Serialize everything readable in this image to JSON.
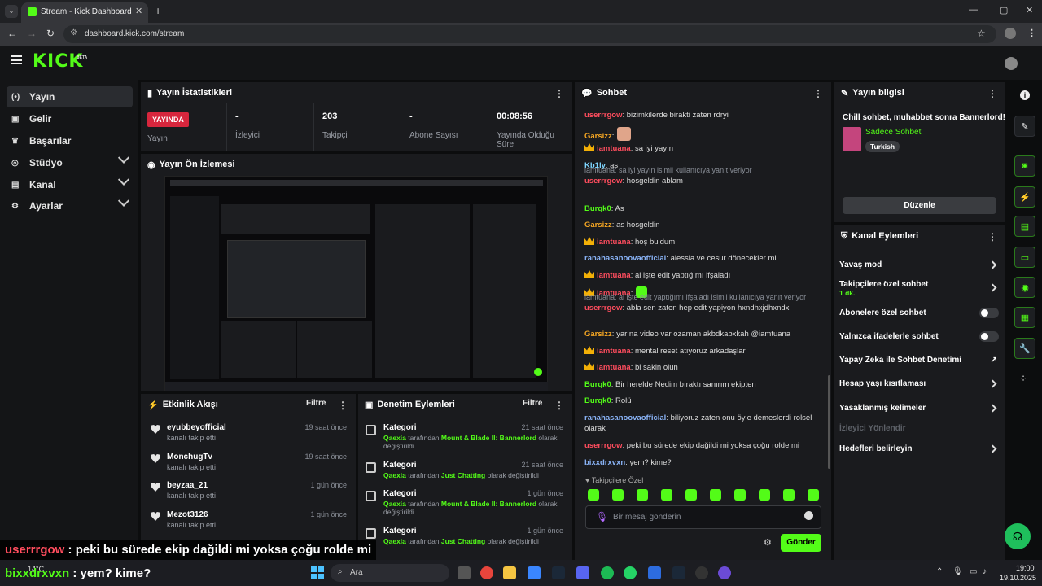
{
  "browser": {
    "tab_title": "Stream - Kick Dashboard",
    "url": "dashboard.kick.com/stream"
  },
  "brand": {
    "logo": "KICK",
    "badge": "BETA"
  },
  "sidebar": {
    "items": [
      {
        "label": "Yayın",
        "icon": "broadcast-icon"
      },
      {
        "label": "Gelir",
        "icon": "revenue-icon"
      },
      {
        "label": "Başarılar",
        "icon": "trophy-icon"
      },
      {
        "label": "Stüdyo",
        "icon": "studio-icon"
      },
      {
        "label": "Kanal",
        "icon": "channel-icon"
      },
      {
        "label": "Ayarlar",
        "icon": "gear-icon"
      }
    ]
  },
  "stats": {
    "title": "Yayın İstatistikleri",
    "live_badge": "YAYINDA",
    "live_label": "Yayın",
    "cells": [
      {
        "value": "-",
        "label": "İzleyici"
      },
      {
        "value": "203",
        "label": "Takipçi"
      },
      {
        "value": "-",
        "label": "Abone Sayısı"
      },
      {
        "value": "00:08:56",
        "label": "Yayında Olduğu Süre"
      }
    ]
  },
  "preview": {
    "title": "Yayın Ön İzlemesi"
  },
  "activity": {
    "title": "Etkinlik Akışı",
    "filter": "Filtre",
    "items": [
      {
        "name": "eyubbeyofficial",
        "sub": "kanalı takip etti",
        "time": "19 saat önce"
      },
      {
        "name": "MonchugTv",
        "sub": "kanalı takip etti",
        "time": "19 saat önce"
      },
      {
        "name": "beyzaa_21",
        "sub": "kanalı takip etti",
        "time": "1 gün önce"
      },
      {
        "name": "Mezot3126",
        "sub": "kanalı takip etti",
        "time": "1 gün önce"
      }
    ]
  },
  "moderation": {
    "title": "Denetim Eylemleri",
    "filter": "Filtre",
    "items": [
      {
        "title": "Kategori",
        "user": "Qaexia",
        "mid": " tarafından ",
        "game": "Mount & Blade II: Bannerlord",
        "end": " olarak değiştirildi",
        "time": "21 saat önce"
      },
      {
        "title": "Kategori",
        "user": "Qaexia",
        "mid": " tarafından ",
        "game": "Just Chatting",
        "end": " olarak değiştirildi",
        "time": "21 saat önce"
      },
      {
        "title": "Kategori",
        "user": "Qaexia",
        "mid": " tarafından ",
        "game": "Mount & Blade II: Bannerlord",
        "end": " olarak değiştirildi",
        "time": "1 gün önce"
      },
      {
        "title": "Kategori",
        "user": "Qaexia",
        "mid": " tarafından ",
        "game": "Just Chatting",
        "end": " olarak değiştirildi",
        "time": "1 gün önce"
      }
    ]
  },
  "chat": {
    "title": "Sohbet",
    "followers_only": "Takipçilere Özel",
    "placeholder": "Bir mesaj gönderin",
    "send": "Gönder",
    "messages": [
      {
        "user": "userrrgow",
        "text": ": bizimkilerde birakti zaten rdryi",
        "color": "#ff4d5e"
      },
      {
        "user": "Garsizz",
        "text": ":",
        "color": "#f5a623"
      },
      {
        "user": "iamtuana",
        "text": ": sa iyi yayın",
        "color": "#ff4d5e",
        "crown": true
      },
      {
        "user": "Kb1ly",
        "text": ": as",
        "color": "#7fd6ff"
      },
      {
        "reply": "iamtuana: sa iyi yayın isimli kullanıcıya yanıt veriyor",
        "user": "userrrgow",
        "text": ": hosgeldin ablam",
        "color": "#ff4d5e"
      },
      {
        "user": "Burqk0",
        "text": ": As",
        "color": "#53fc18"
      },
      {
        "user": "Garsizz",
        "text": ": as hosgeldin",
        "color": "#f5a623"
      },
      {
        "user": "iamtuana",
        "text": ": hoş buldum",
        "color": "#ff4d5e",
        "crown": true
      },
      {
        "user": "ranahasanoovaofficial",
        "text": ": alessia ve cesur dönecekler mi",
        "color": "#8ab4f8"
      },
      {
        "user": "iamtuana",
        "text": ": al işte edit yaptığımı ifşaladı",
        "color": "#ff4d5e",
        "crown": true
      },
      {
        "user": "iamtuana",
        "text": ":",
        "color": "#ff4d5e",
        "crown": true
      },
      {
        "reply": "iamtuana: al işte edit yaptığımı ifşaladı isimli kullanıcıya yanıt veriyor",
        "user": "userrrgow",
        "text": ": abla sen zaten hep edit yapiyon hxndhxjdhxndx",
        "color": "#ff4d5e"
      },
      {
        "user": "Garsizz",
        "text": ": yarına video var ozaman akbdkabxkah @iamtuana",
        "color": "#f5a623"
      },
      {
        "user": "iamtuana",
        "text": ": mental reset atıyoruz arkadaşlar",
        "color": "#ff4d5e",
        "crown": true
      },
      {
        "user": "iamtuana",
        "text": ": bi sakin olun",
        "color": "#ff4d5e",
        "crown": true
      },
      {
        "user": "Burqk0",
        "text": ": Bir herelde Nedim bıraktı sanırım ekipten",
        "color": "#53fc18"
      },
      {
        "user": "Burqk0",
        "text": ": Rolü",
        "color": "#53fc18"
      },
      {
        "user": "ranahasanoovaofficial",
        "text": ": biliyoruz zaten onu öyle demeslerdi rolsel olarak",
        "color": "#8ab4f8"
      },
      {
        "user": "userrrgow",
        "text": ": peki bu sürede ekip dağildi mi yoksa çoğu rolde mi",
        "color": "#ff4d5e"
      },
      {
        "user": "bixxdrxvxn",
        "text": ": yem? kime?",
        "color": "#8ab4f8"
      }
    ]
  },
  "info": {
    "title": "Yayın bilgisi",
    "stream_title": "Chill sohbet, muhabbet sonra Bannerlord!",
    "category": "Sadece Sohbet",
    "language": "Turkish",
    "edit": "Düzenle"
  },
  "actions": {
    "title": "Kanal Eylemleri",
    "items": [
      {
        "label": "Yavaş mod",
        "type": "chevron"
      },
      {
        "label": "Takipçilere özel sohbet",
        "sub": "1 dk.",
        "type": "chevron"
      },
      {
        "label": "Abonelere özel sohbet",
        "type": "toggle"
      },
      {
        "label": "Yalnızca ifadelerle sohbet",
        "type": "toggle"
      },
      {
        "label": "Yapay Zeka ile Sohbet Denetimi",
        "type": "external"
      },
      {
        "label": "Hesap yaşı kısıtlaması",
        "type": "chevron"
      },
      {
        "label": "Yasaklanmış kelimeler",
        "type": "chevron"
      },
      {
        "label": "İzleyici Yönlendir",
        "type": "disabled"
      },
      {
        "label": "Hedefleri belirleyin",
        "type": "chevron"
      }
    ]
  },
  "overlay": {
    "line1_user": "userrrgow",
    "line1_text": " : peki bu sürede ekip dağildi mi yoksa çoğu rolde mi",
    "line2_user": "bixxdrxvxn",
    "line2_text": " : yem? kime?"
  },
  "taskbar": {
    "search": "Ara",
    "temp": "14°C",
    "time": "19:00",
    "date": "19.10.2025"
  }
}
